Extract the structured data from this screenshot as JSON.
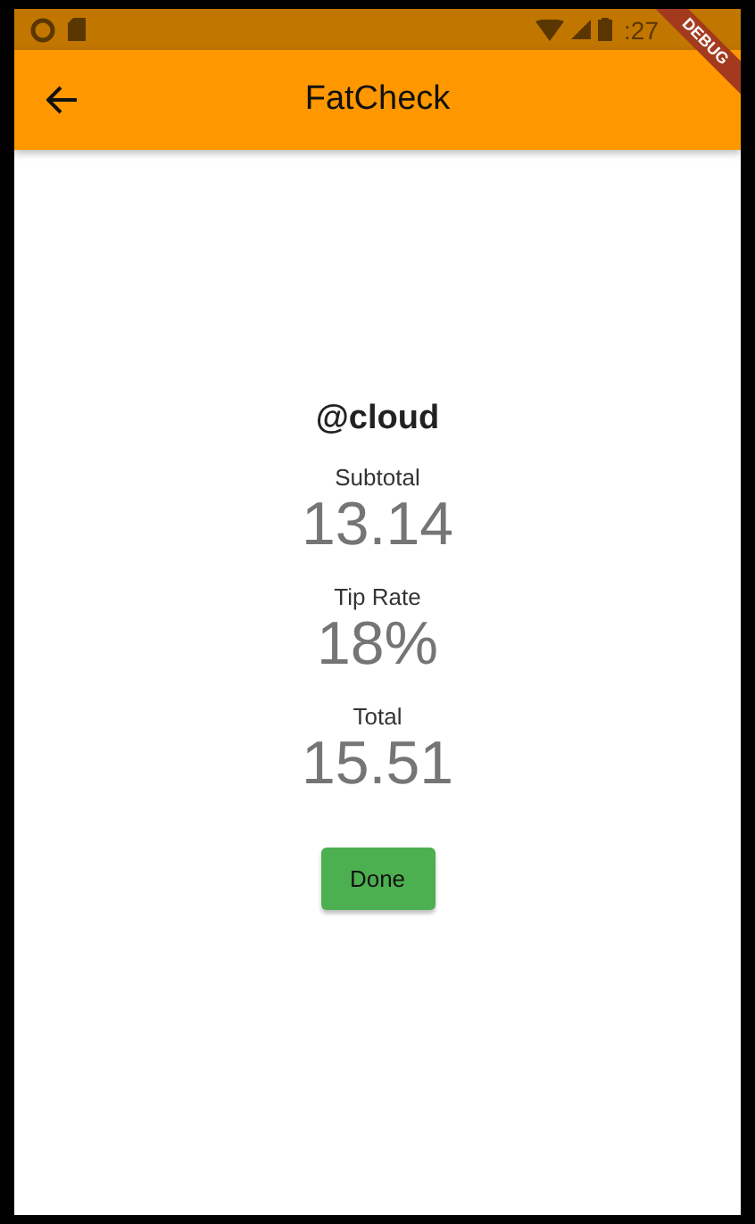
{
  "status_bar": {
    "time": ":27"
  },
  "debug_banner": "DEBUG",
  "app_bar": {
    "title": "FatCheck"
  },
  "username": "@cloud",
  "fields": [
    {
      "label": "Subtotal",
      "value": "13.14"
    },
    {
      "label": "Tip Rate",
      "value": "18%"
    },
    {
      "label": "Total",
      "value": "15.51"
    }
  ],
  "buttons": [
    "Done"
  ]
}
